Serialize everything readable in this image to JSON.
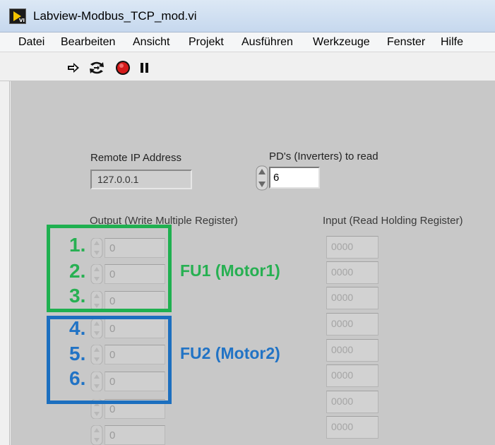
{
  "window": {
    "title": "Labview-Modbus_TCP_mod.vi"
  },
  "menu": [
    "Datei",
    "Bearbeiten",
    "Ansicht",
    "Projekt",
    "Ausführen",
    "Werkzeuge",
    "Fenster",
    "Hilfe"
  ],
  "toolbar": [
    "run-arrow-icon",
    "run-continuously-icon",
    "abort-execution-icon",
    "pause-icon"
  ],
  "remote_ip": {
    "label": "Remote IP Address",
    "value": "127.0.0.1"
  },
  "pds": {
    "label": "PD's (Inverters) to read",
    "value": "6"
  },
  "output": {
    "label": "Output (Write Multiple Register)",
    "values": [
      "0",
      "0",
      "0",
      "0",
      "0",
      "0",
      "0",
      "0"
    ]
  },
  "input": {
    "label": "Input (Read Holding Register)",
    "values": [
      "0000",
      "0000",
      "0000",
      "0000",
      "0000",
      "0000",
      "0000",
      "0000"
    ]
  },
  "annotations": {
    "numbers": [
      "1.",
      "2.",
      "3.",
      "4.",
      "5.",
      "6."
    ],
    "fu1": "FU1 (Motor1)",
    "fu2": "FU2 (Motor2)",
    "colors": {
      "fu1": "#1fb050",
      "fu2": "#1c6fbf"
    }
  }
}
